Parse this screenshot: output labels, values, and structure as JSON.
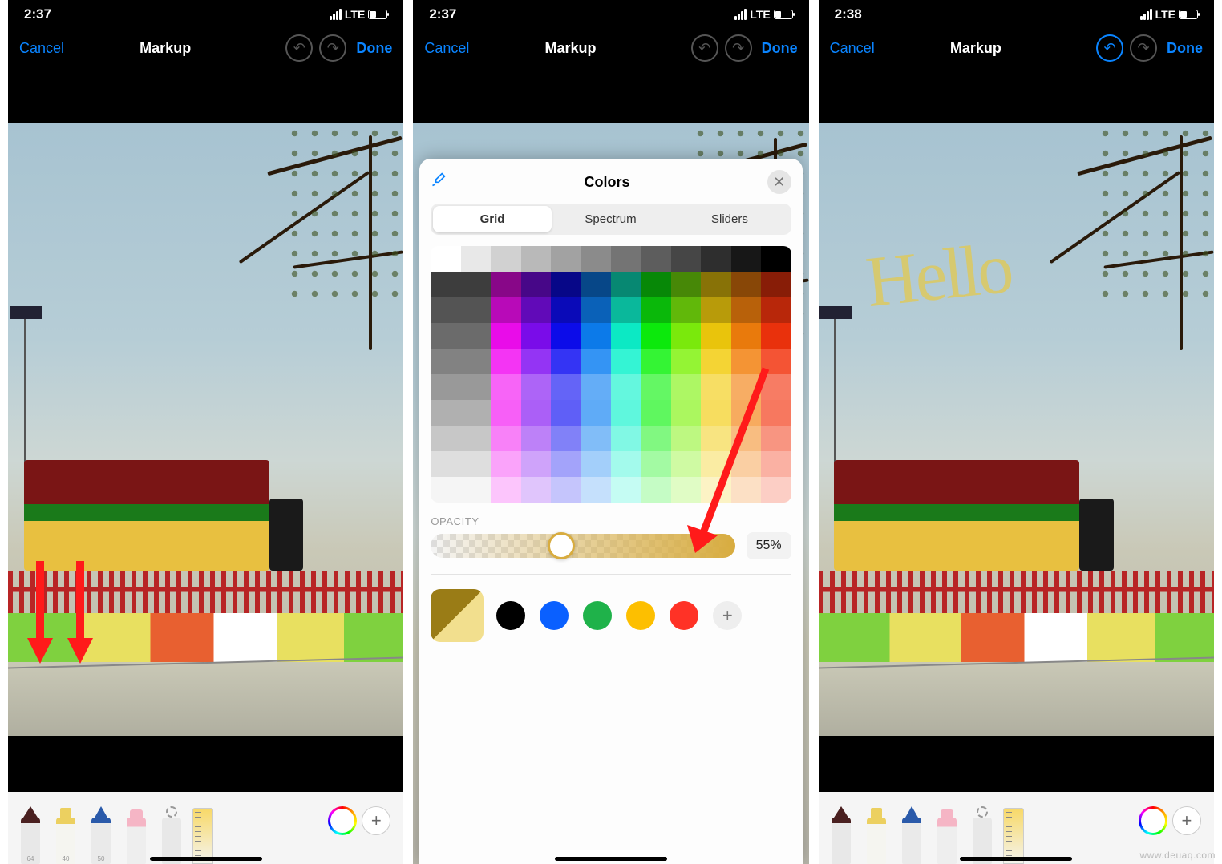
{
  "screens": [
    {
      "time": "2:37",
      "net": "LTE",
      "cancel": "Cancel",
      "title": "Markup",
      "done": "Done",
      "undo_active": false,
      "tool_labels": [
        "64",
        "40",
        "50",
        "",
        ""
      ],
      "arrows_target": "tools"
    },
    {
      "time": "2:37",
      "net": "LTE",
      "cancel": "Cancel",
      "title": "Markup",
      "done": "Done",
      "undo_active": false
    },
    {
      "time": "2:38",
      "net": "LTE",
      "cancel": "Cancel",
      "title": "Markup",
      "done": "Done",
      "undo_active": true,
      "handwriting": "Hello"
    }
  ],
  "color_picker": {
    "title": "Colors",
    "tabs": [
      "Grid",
      "Spectrum",
      "Sliders"
    ],
    "active_tab": "Grid",
    "opacity_label": "OPACITY",
    "opacity_value": "55%",
    "opacity_fraction": 0.43,
    "selected_color": "#d8ac3f",
    "big_swatch_colors": [
      "#9a7c16",
      "#f2df8e"
    ],
    "preset_swatches": [
      "#000000",
      "#0a60ff",
      "#1fb24a",
      "#fdbf00",
      "#ff3226"
    ],
    "grid_hues": [
      0,
      0,
      300,
      270,
      240,
      210,
      170,
      120,
      90,
      50,
      30,
      10
    ],
    "grid_is_greyscale_row": true
  },
  "watermark": "www.deuaq.com"
}
